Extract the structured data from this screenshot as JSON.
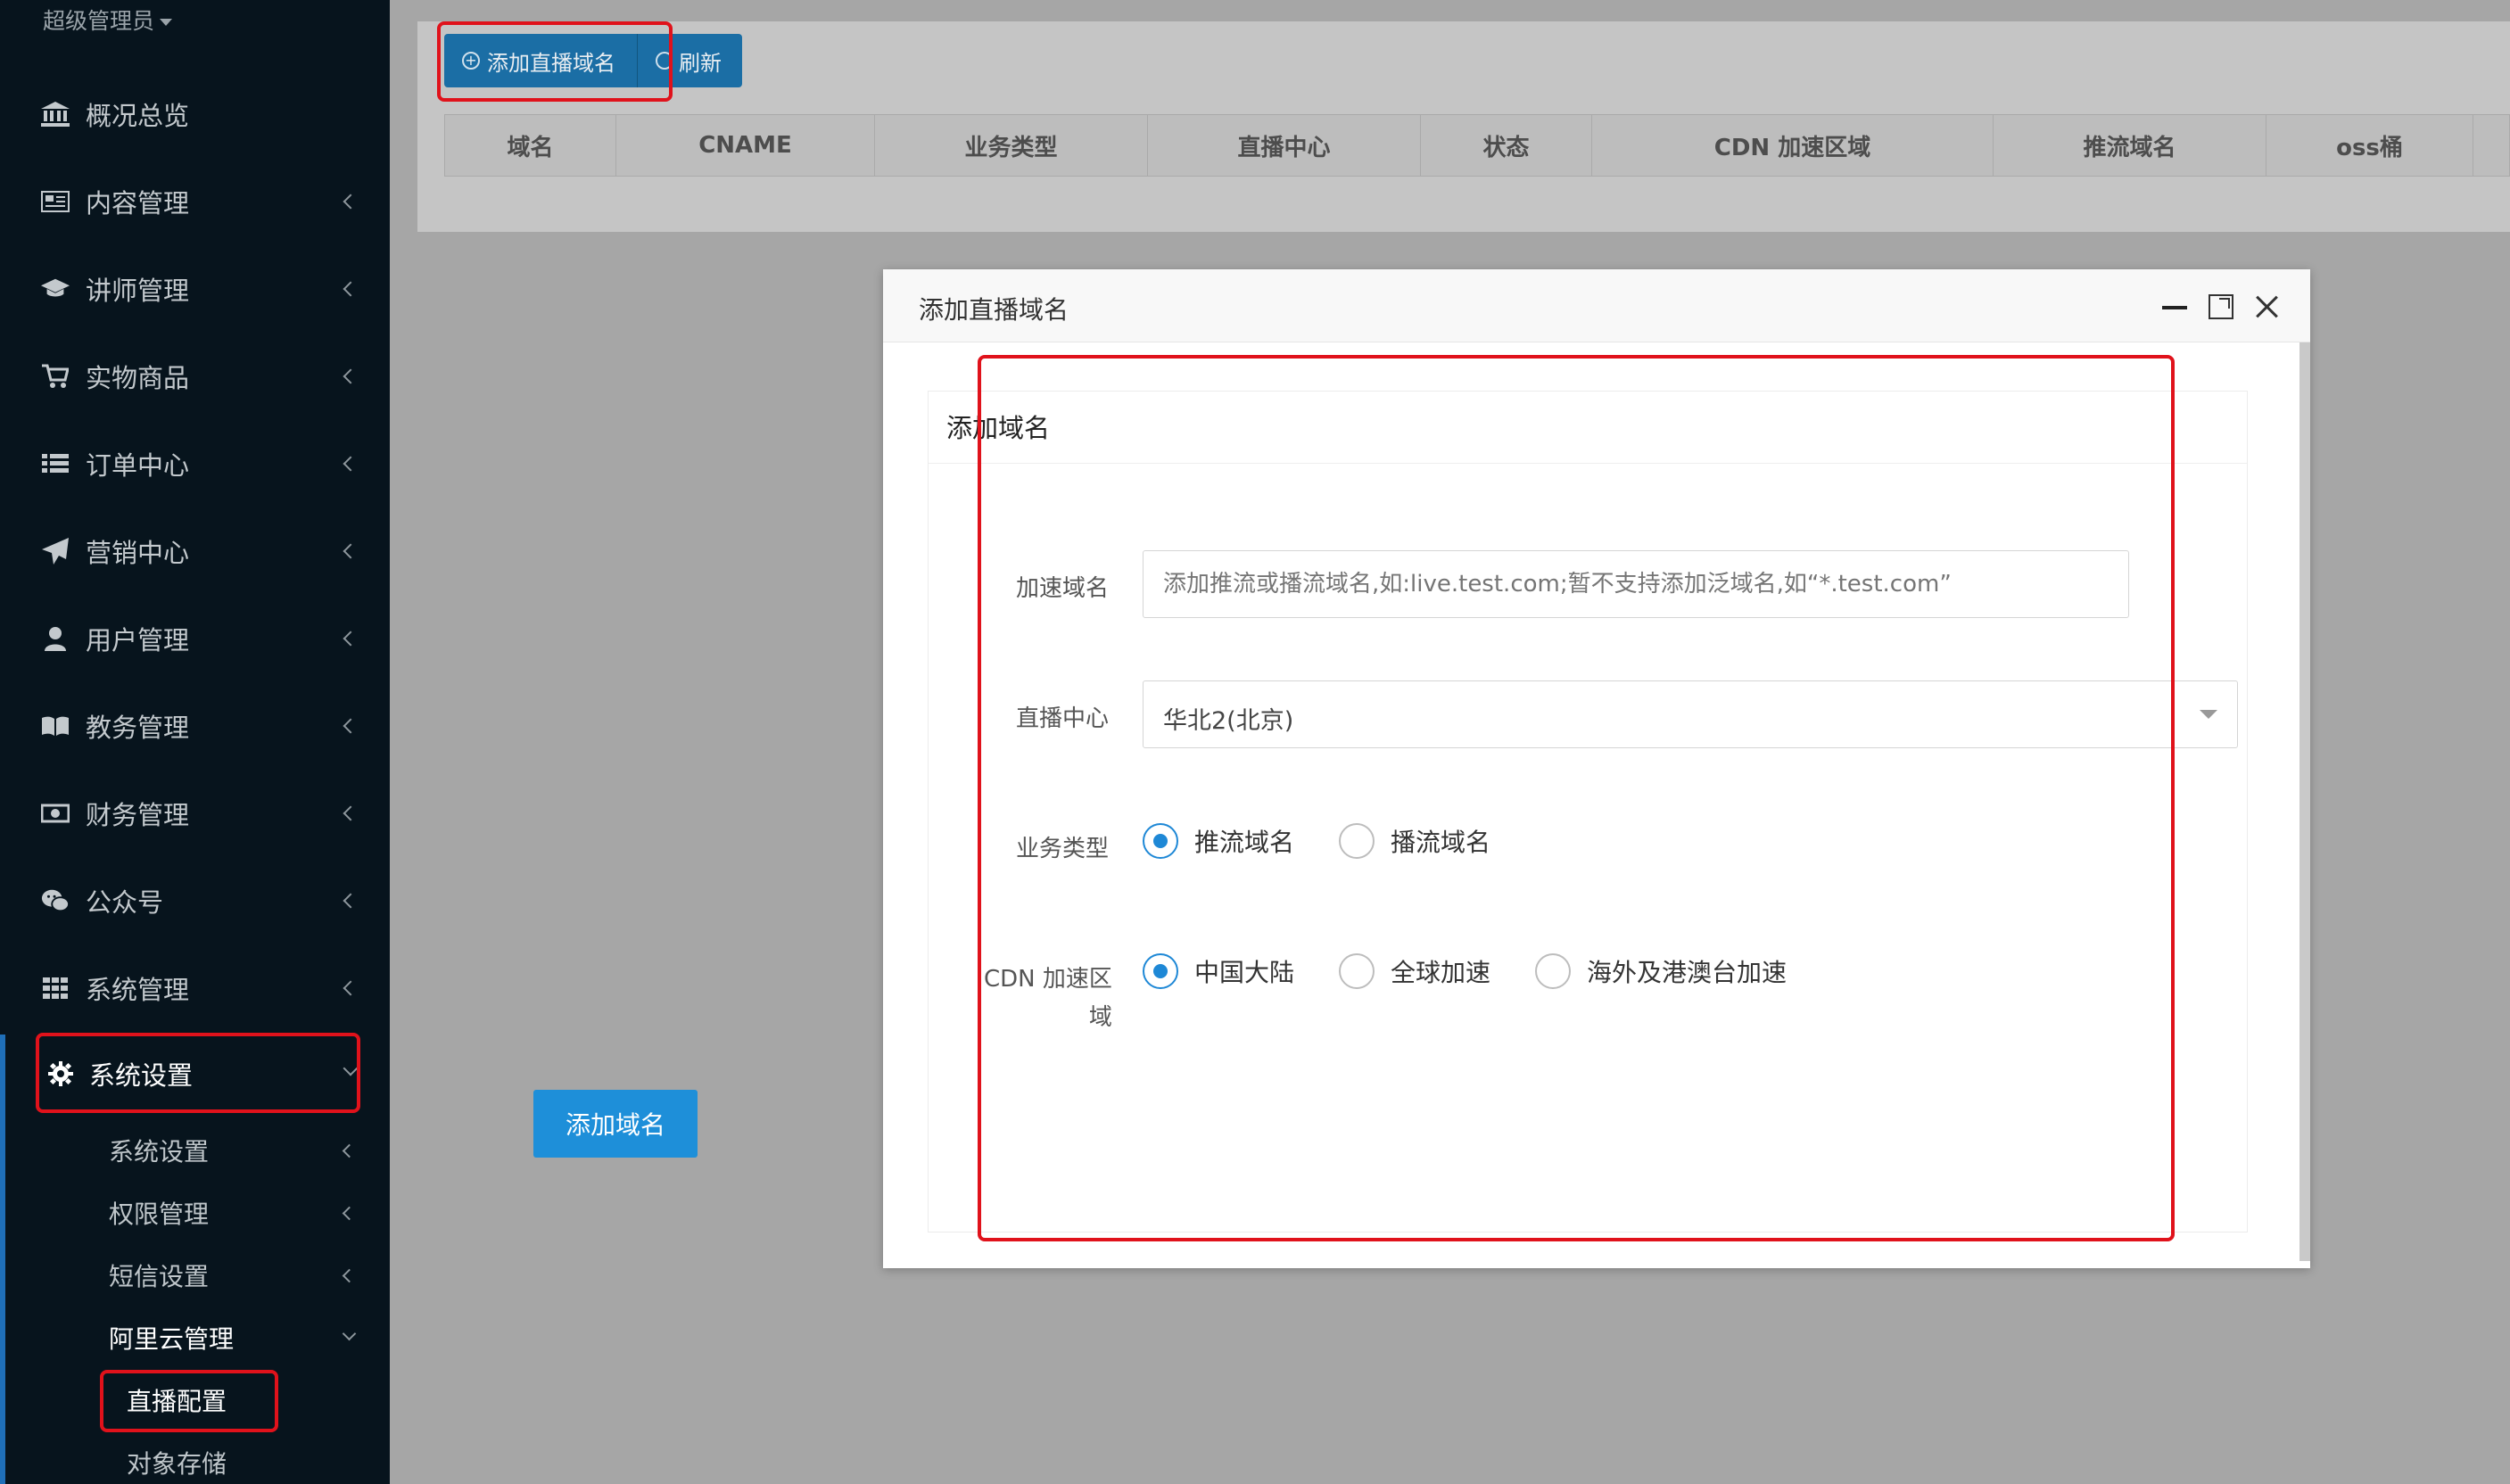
{
  "sidebar": {
    "user": "超级管理员",
    "items": [
      {
        "label": "概况总览",
        "icon": "bank-icon"
      },
      {
        "label": "内容管理",
        "icon": "newspaper-icon"
      },
      {
        "label": "讲师管理",
        "icon": "graduation-cap-icon"
      },
      {
        "label": "实物商品",
        "icon": "cart-icon"
      },
      {
        "label": "订单中心",
        "icon": "list-icon"
      },
      {
        "label": "营销中心",
        "icon": "paper-plane-icon"
      },
      {
        "label": "用户管理",
        "icon": "user-icon"
      },
      {
        "label": "教务管理",
        "icon": "book-icon"
      },
      {
        "label": "财务管理",
        "icon": "money-icon"
      },
      {
        "label": "公众号",
        "icon": "wechat-icon"
      },
      {
        "label": "系统管理",
        "icon": "grid-icon"
      },
      {
        "label": "系统设置",
        "icon": "gear-icon"
      }
    ],
    "sub_items": [
      {
        "label": "系统设置"
      },
      {
        "label": "权限管理"
      },
      {
        "label": "短信设置"
      },
      {
        "label": "阿里云管理"
      }
    ],
    "sub2_items": [
      {
        "label": "直播配置"
      },
      {
        "label": "对象存储"
      }
    ]
  },
  "toolbar": {
    "add_label": "添加直播域名",
    "refresh_label": "刷新"
  },
  "table": {
    "columns": [
      "域名",
      "CNAME",
      "业务类型",
      "直播中心",
      "状态",
      "CDN 加速区域",
      "推流域名",
      "oss桶"
    ]
  },
  "modal": {
    "title": "添加直播域名",
    "card_title": "添加域名",
    "domain_label": "加速域名",
    "domain_value": "添加推流或播流域名,如:live.test.com;暂不支持添加泛域名,如“*.test.com”",
    "center_label": "直播中心",
    "center_value": "华北2(北京)",
    "type_label": "业务类型",
    "type_options": [
      {
        "label": "推流域名",
        "checked": true
      },
      {
        "label": "播流域名",
        "checked": false
      }
    ],
    "region_label_line1": "CDN 加速区",
    "region_label_line2": "域",
    "region_options": [
      {
        "label": "中国大陆",
        "checked": true
      },
      {
        "label": "全球加速",
        "checked": false
      },
      {
        "label": "海外及港澳台加速",
        "checked": false
      }
    ],
    "submit_label": "添加域名"
  },
  "colors": {
    "sidebar_bg": "#07141d",
    "primary": "#1e8fd9",
    "annotation": "#e0121b"
  }
}
